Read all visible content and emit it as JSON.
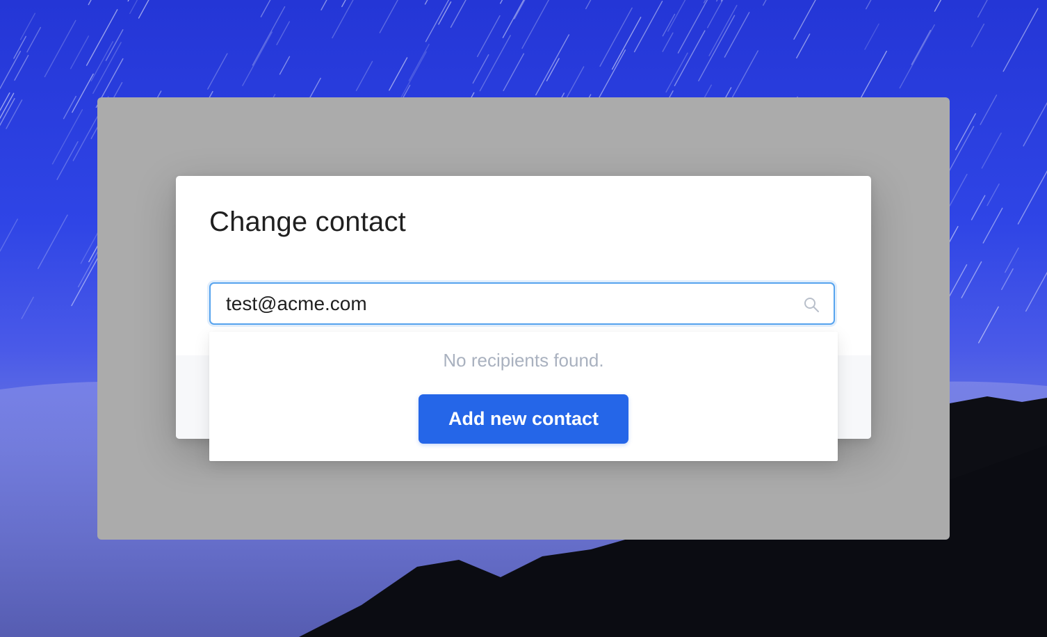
{
  "dialog": {
    "title": "Change contact"
  },
  "search": {
    "value": "test@acme.com",
    "icon": "search-icon"
  },
  "dropdown": {
    "empty_message": "No recipients found.",
    "add_button_label": "Add new contact"
  },
  "colors": {
    "accent": "#2566e8",
    "focus_ring": "#56a3ee",
    "muted_text": "#a9b1bf",
    "overlay": "#ababab"
  }
}
